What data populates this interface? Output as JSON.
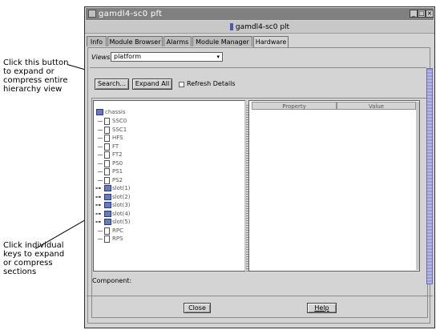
{
  "callouts": {
    "expand_all": "Click this button\nto expand or\ncompress  entire\nhierarchy  view",
    "keys": "Click  individual\nkeys  to expand\nor  compress\nsections"
  },
  "window": {
    "title": "gamdl4-sc0 pft ",
    "subtitle": "gamdl4-sc0 plt"
  },
  "tabs": [
    {
      "label": "Info"
    },
    {
      "label": "Module Browser"
    },
    {
      "label": "Alarms"
    },
    {
      "label": "Module Manager"
    },
    {
      "label": "Hardware"
    }
  ],
  "views": {
    "label": "Views",
    "value": "platform"
  },
  "toolbar": {
    "search_label": "Search...",
    "expand_all_label": "Expand All",
    "refresh_details_label": "Refresh Details"
  },
  "tree": {
    "root": "chassis",
    "items": [
      {
        "label": "SSC0",
        "kind": "doc",
        "key": false
      },
      {
        "label": "SSC1",
        "kind": "doc",
        "key": false
      },
      {
        "label": "HFS",
        "kind": "doc",
        "key": false
      },
      {
        "label": "FT",
        "kind": "doc",
        "key": false
      },
      {
        "label": "FT2",
        "kind": "doc",
        "key": false
      },
      {
        "label": "PS0",
        "kind": "doc",
        "key": false
      },
      {
        "label": "PS1",
        "kind": "doc",
        "key": false
      },
      {
        "label": "PS2",
        "kind": "doc",
        "key": false
      },
      {
        "label": "slot(1)",
        "kind": "folder",
        "key": true
      },
      {
        "label": "slot(2)",
        "kind": "folder",
        "key": true
      },
      {
        "label": "slot(3)",
        "kind": "folder",
        "key": true
      },
      {
        "label": "slot(4)",
        "kind": "folder",
        "key": true
      },
      {
        "label": "slot(5)",
        "kind": "folder",
        "key": true
      },
      {
        "label": "RPC",
        "kind": "doc",
        "key": false
      },
      {
        "label": "RPS",
        "kind": "doc",
        "key": false
      }
    ]
  },
  "table": {
    "columns": [
      "Property",
      "Value"
    ]
  },
  "component": {
    "label": "Component:"
  },
  "footer": {
    "close_label": "Close",
    "help_label": "Help"
  }
}
